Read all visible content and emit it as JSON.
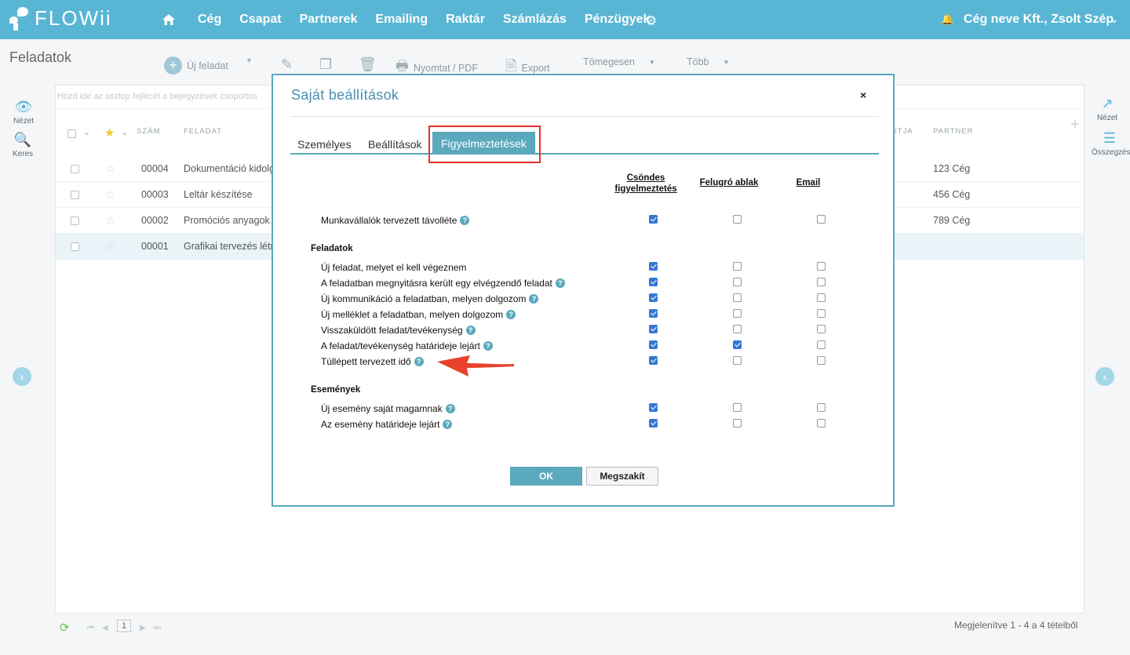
{
  "nav": {
    "logo": "FLOWii",
    "items": [
      "Cég",
      "Csapat",
      "Partnerek",
      "Emailing",
      "Raktár",
      "Számlázás",
      "Pénzügyek"
    ],
    "user": "Cég neve Kft., Zsolt Szép"
  },
  "toolbar": {
    "page_title": "Feladatok",
    "new_task": "Új feladat",
    "print": "Nyomtat / PDF",
    "export": "Export",
    "bulk": "Tömegesen",
    "more": "Több"
  },
  "rail": {
    "view_left": "Nézet",
    "search_left": "Keres",
    "view_right": "Nézet",
    "summary_right": "Összegzés"
  },
  "grid": {
    "group_hint": "Húzd ide az oszlop fejlécét a bejegyzések csoportos",
    "columns": {
      "number": "SZÁM",
      "task": "FELADAT",
      "owner_partial": "ÍTJA",
      "partner": "PARTNER"
    },
    "rows": [
      {
        "number": "00004",
        "task": "Dokumentáció kidolg",
        "partner": "123 Cég"
      },
      {
        "number": "00003",
        "task": "Leltár készítése",
        "partner": "456 Cég"
      },
      {
        "number": "00002",
        "task": "Promóciós anyagok r",
        "partner": "789 Cég"
      },
      {
        "number": "00001",
        "task": "Grafikai tervezés létr",
        "partner": ""
      }
    ],
    "page": "1",
    "footer_count": "Megjelenítve 1 - 4 a 4 tételből"
  },
  "modal": {
    "title": "Saját beállítások",
    "close": "×",
    "tabs": [
      "Személyes",
      "Beállítások",
      "Figyelmeztetések"
    ],
    "columns": {
      "silent_1": "Csöndes",
      "silent_2": "figyelmeztetés",
      "popup": "Felugró ablak",
      "email": "Email"
    },
    "top_option": {
      "label": "Munkavállalók tervezett távolléte",
      "checks": [
        true,
        false,
        false
      ]
    },
    "sections": [
      {
        "title": "Feladatok",
        "options": [
          {
            "label": "Új feladat, melyet el kell végeznem",
            "help": false,
            "checks": [
              true,
              false,
              false
            ]
          },
          {
            "label": "A feladatban megnyitásra került egy elvégzendő feladat",
            "help": true,
            "checks": [
              true,
              false,
              false
            ]
          },
          {
            "label": "Új kommunikáció a feladatban, melyen dolgozom",
            "help": true,
            "checks": [
              true,
              false,
              false
            ]
          },
          {
            "label": "Új melléklet a feladatban, melyen dolgozom",
            "help": true,
            "checks": [
              true,
              false,
              false
            ]
          },
          {
            "label": "Visszaküldött feladat/tevékenység",
            "help": true,
            "checks": [
              true,
              false,
              false
            ]
          },
          {
            "label": "A feladat/tevékenység határideje lejárt",
            "help": true,
            "checks": [
              true,
              true,
              false
            ]
          },
          {
            "label": "Túllépett tervezett idő",
            "help": true,
            "checks": [
              true,
              false,
              false
            ]
          }
        ]
      },
      {
        "title": "Események",
        "options": [
          {
            "label": "Új esemény saját magamnak",
            "help": true,
            "checks": [
              true,
              false,
              false
            ]
          },
          {
            "label": "Az esemény határideje lejárt",
            "help": true,
            "checks": [
              true,
              false,
              false
            ]
          }
        ]
      }
    ],
    "ok": "OK",
    "cancel": "Megszakít"
  },
  "colors": {
    "brand": "#58b6d4",
    "modal_border": "#5aa9bd",
    "highlight": "#e0352b"
  }
}
